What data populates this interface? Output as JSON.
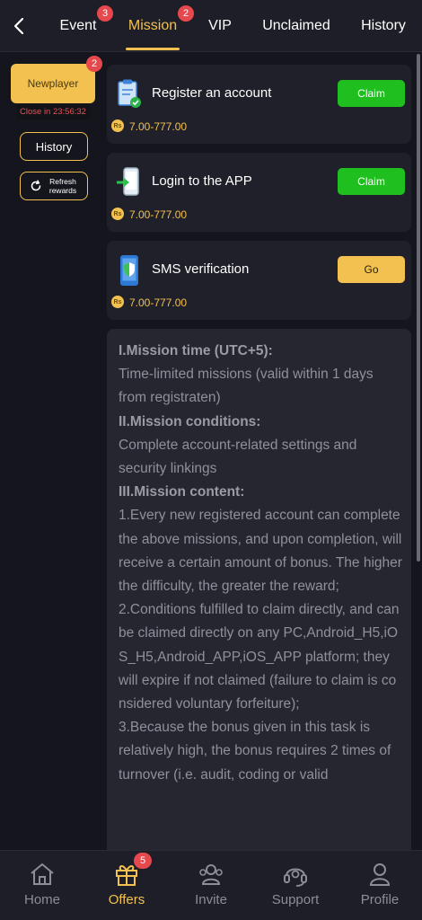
{
  "header": {
    "back_icon": "chevron-left-icon",
    "tabs": [
      {
        "label": "Event",
        "badge": "3",
        "active": false
      },
      {
        "label": "Mission",
        "badge": "2",
        "active": true
      },
      {
        "label": "VIP",
        "active": false
      },
      {
        "label": "Unclaimed",
        "active": false
      },
      {
        "label": "History",
        "active": false
      }
    ]
  },
  "sidebar": {
    "newplayer_label": "Newplayer",
    "newplayer_badge": "2",
    "countdown": "Close in 23:56:32",
    "history_label": "History",
    "refresh_label": "Refresh rewards"
  },
  "missions": [
    {
      "title": "Register an account",
      "reward": "7.00-777.00",
      "action": "Claim",
      "icon": "clipboard-check-icon"
    },
    {
      "title": "Login to the APP",
      "reward": "7.00-777.00",
      "action": "Claim",
      "icon": "phone-login-icon"
    },
    {
      "title": "SMS verification",
      "reward": "7.00-777.00",
      "action": "Go",
      "icon": "phone-shield-icon"
    }
  ],
  "currency_symbol": "Rs",
  "rules": {
    "h1": "I.Mission time (UTC+5):",
    "p1": "Time-limited missions (valid within 1 days from registraten)",
    "h2": "II.Mission conditions:",
    "p2": "Complete account-related settings and security linkings",
    "h3": "III.Mission content:",
    "p3": "1.Every new registered account can complete the above missions, and upon completion, will receive a certain amount of bonus. The higher the difficulty, the greater the reward;",
    "p4": "2.Conditions fulfilled to claim directly, and can be claimed directly on any PC,Android_H5,iOS_H5,Android_APP,iOS_APP platform; they will expire if not claimed (failure to claim is considered voluntary forfeiture);",
    "p5": "3.Because the bonus given in this task is relatively high, the bonus requires 2 times of turnover (i.e. audit, coding or valid"
  },
  "bottom_nav": [
    {
      "label": "Home",
      "icon": "home-icon",
      "active": false
    },
    {
      "label": "Offers",
      "icon": "gift-icon",
      "active": true,
      "badge": "5"
    },
    {
      "label": "Invite",
      "icon": "invite-people-icon",
      "active": false
    },
    {
      "label": "Support",
      "icon": "headset-icon",
      "active": false
    },
    {
      "label": "Profile",
      "icon": "profile-icon",
      "active": false
    }
  ],
  "colors": {
    "accent": "#f3c14f",
    "claim_green": "#1fbf1f",
    "badge_red": "#e5484d",
    "background": "#15161d"
  }
}
